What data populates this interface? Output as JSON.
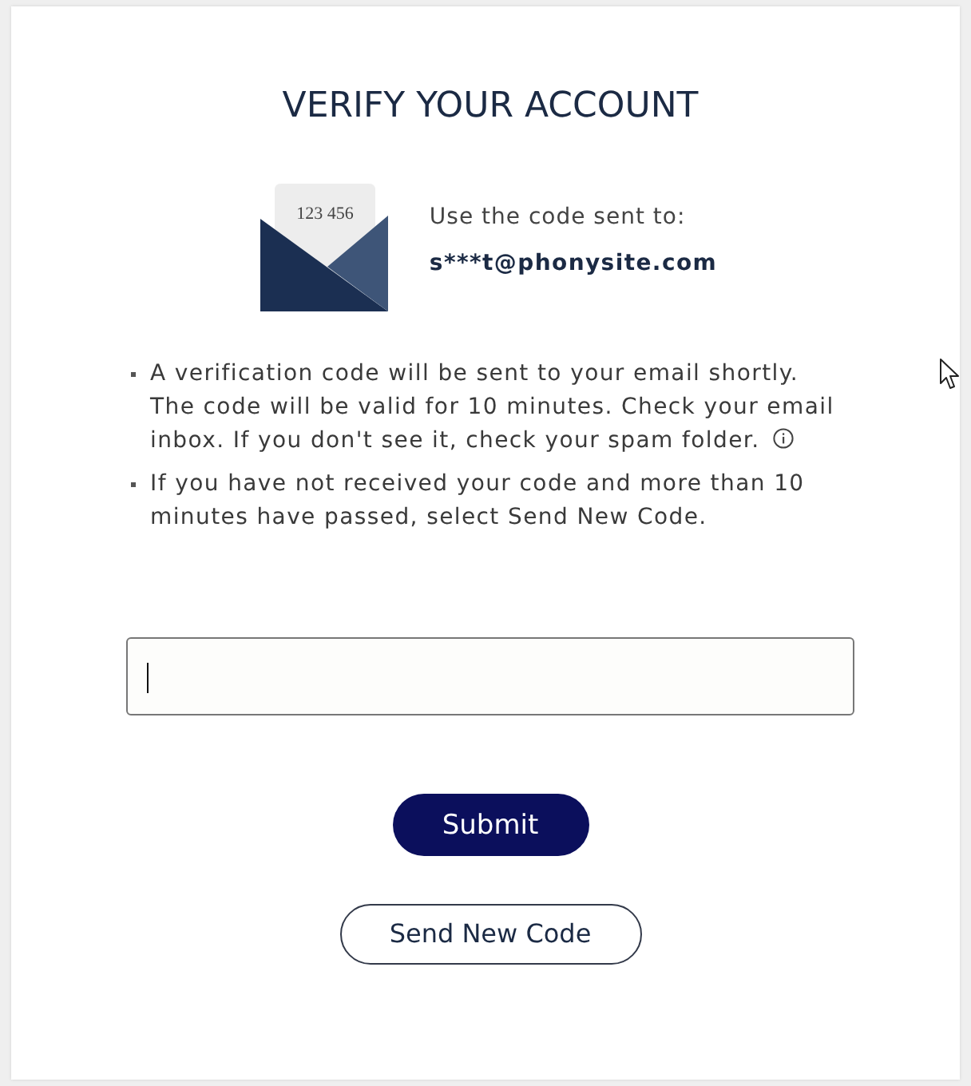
{
  "title": "VERIFY YOUR ACCOUNT",
  "envelope": {
    "code": "123 456"
  },
  "destination": {
    "label": "Use the code sent to:",
    "email": "s***t@phonysite.com"
  },
  "notes": [
    {
      "text": "A verification code will be sent to your email shortly. The code will be valid for 10 minutes. Check your email inbox. If you don't see it, check your spam folder.",
      "info": true
    },
    {
      "text": "If you have not received your code and more than 10 minutes have passed, select Send New Code.",
      "info": false
    }
  ],
  "code_field": {
    "focused": true
  },
  "buttons": [
    {
      "kind": "primary",
      "label": "Submit"
    },
    {
      "kind": "secondary",
      "label": "Send New Code"
    }
  ]
}
